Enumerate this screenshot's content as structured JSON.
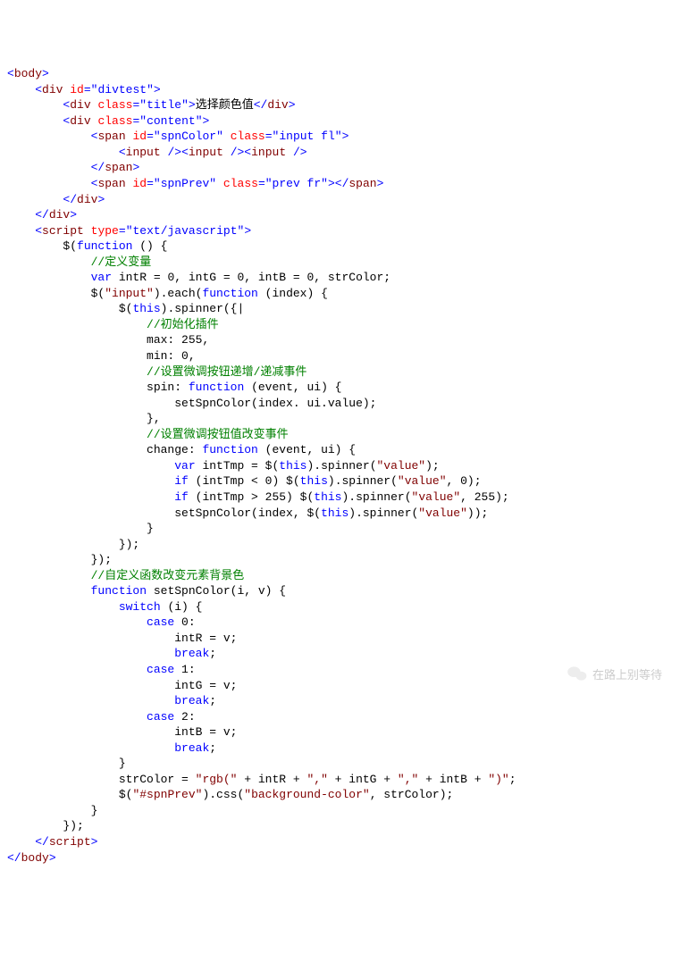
{
  "watermark": {
    "text": "在路上别等待"
  },
  "code": {
    "lines": [
      [
        [
          "tag",
          "<"
        ],
        [
          "name",
          "body"
        ],
        [
          "tag",
          ">"
        ]
      ],
      [
        [
          "plain",
          "    "
        ],
        [
          "tag",
          "<"
        ],
        [
          "name",
          "div"
        ],
        [
          "plain",
          " "
        ],
        [
          "attr",
          "id"
        ],
        [
          "tag",
          "="
        ],
        [
          "val",
          "\"divtest\""
        ],
        [
          "tag",
          ">"
        ]
      ],
      [
        [
          "plain",
          "        "
        ],
        [
          "tag",
          "<"
        ],
        [
          "name",
          "div"
        ],
        [
          "plain",
          " "
        ],
        [
          "attr",
          "class"
        ],
        [
          "tag",
          "="
        ],
        [
          "val",
          "\"title\""
        ],
        [
          "tag",
          ">"
        ],
        [
          "plain",
          "选择颜色值"
        ],
        [
          "tag",
          "</"
        ],
        [
          "name",
          "div"
        ],
        [
          "tag",
          ">"
        ]
      ],
      [
        [
          "plain",
          "        "
        ],
        [
          "tag",
          "<"
        ],
        [
          "name",
          "div"
        ],
        [
          "plain",
          " "
        ],
        [
          "attr",
          "class"
        ],
        [
          "tag",
          "="
        ],
        [
          "val",
          "\"content\""
        ],
        [
          "tag",
          ">"
        ]
      ],
      [
        [
          "plain",
          "            "
        ],
        [
          "tag",
          "<"
        ],
        [
          "name",
          "span"
        ],
        [
          "plain",
          " "
        ],
        [
          "attr",
          "id"
        ],
        [
          "tag",
          "="
        ],
        [
          "val",
          "\"spnColor\""
        ],
        [
          "plain",
          " "
        ],
        [
          "attr",
          "class"
        ],
        [
          "tag",
          "="
        ],
        [
          "val",
          "\"input fl\""
        ],
        [
          "tag",
          ">"
        ]
      ],
      [
        [
          "plain",
          "                "
        ],
        [
          "tag",
          "<"
        ],
        [
          "name",
          "input"
        ],
        [
          "plain",
          " "
        ],
        [
          "tag",
          "/><"
        ],
        [
          "name",
          "input"
        ],
        [
          "plain",
          " "
        ],
        [
          "tag",
          "/><"
        ],
        [
          "name",
          "input"
        ],
        [
          "plain",
          " "
        ],
        [
          "tag",
          "/>"
        ]
      ],
      [
        [
          "plain",
          "            "
        ],
        [
          "tag",
          "</"
        ],
        [
          "name",
          "span"
        ],
        [
          "tag",
          ">"
        ]
      ],
      [
        [
          "plain",
          "            "
        ],
        [
          "tag",
          "<"
        ],
        [
          "name",
          "span"
        ],
        [
          "plain",
          " "
        ],
        [
          "attr",
          "id"
        ],
        [
          "tag",
          "="
        ],
        [
          "val",
          "\"spnPrev\""
        ],
        [
          "plain",
          " "
        ],
        [
          "attr",
          "class"
        ],
        [
          "tag",
          "="
        ],
        [
          "val",
          "\"prev fr\""
        ],
        [
          "tag",
          "></"
        ],
        [
          "name",
          "span"
        ],
        [
          "tag",
          ">"
        ]
      ],
      [
        [
          "plain",
          "        "
        ],
        [
          "tag",
          "</"
        ],
        [
          "name",
          "div"
        ],
        [
          "tag",
          ">"
        ]
      ],
      [
        [
          "plain",
          "    "
        ],
        [
          "tag",
          "</"
        ],
        [
          "name",
          "div"
        ],
        [
          "tag",
          ">"
        ]
      ],
      [
        [
          "plain",
          "    "
        ],
        [
          "tag",
          "<"
        ],
        [
          "name",
          "script"
        ],
        [
          "plain",
          " "
        ],
        [
          "attr",
          "type"
        ],
        [
          "tag",
          "="
        ],
        [
          "val",
          "\"text/javascript\""
        ],
        [
          "tag",
          ">"
        ]
      ],
      [
        [
          "plain",
          "        $("
        ],
        [
          "kw",
          "function"
        ],
        [
          "plain",
          " () {"
        ]
      ],
      [
        [
          "plain",
          "            "
        ],
        [
          "cmt",
          "//定义变量"
        ]
      ],
      [
        [
          "plain",
          "            "
        ],
        [
          "kw",
          "var"
        ],
        [
          "plain",
          " intR = 0, intG = 0, intB = 0, strColor;"
        ]
      ],
      [
        [
          "plain",
          "            $("
        ],
        [
          "str",
          "\"input\""
        ],
        [
          "plain",
          ").each("
        ],
        [
          "kw",
          "function"
        ],
        [
          "plain",
          " (index) {"
        ]
      ],
      [
        [
          "plain",
          "                $("
        ],
        [
          "kw",
          "this"
        ],
        [
          "plain",
          ").spinner({|"
        ]
      ],
      [
        [
          "plain",
          "                    "
        ],
        [
          "cmt",
          "//初始化插件"
        ]
      ],
      [
        [
          "plain",
          "                    max: 255,"
        ]
      ],
      [
        [
          "plain",
          "                    min: 0,"
        ]
      ],
      [
        [
          "plain",
          "                    "
        ],
        [
          "cmt",
          "//设置微调按钮递增/递减事件"
        ]
      ],
      [
        [
          "plain",
          "                    spin: "
        ],
        [
          "kw",
          "function"
        ],
        [
          "plain",
          " (event, ui) {"
        ]
      ],
      [
        [
          "plain",
          "                        setSpnColor(index. ui.value);"
        ]
      ],
      [
        [
          "plain",
          "                    },"
        ]
      ],
      [
        [
          "plain",
          "                    "
        ],
        [
          "cmt",
          "//设置微调按钮值改变事件"
        ]
      ],
      [
        [
          "plain",
          "                    change: "
        ],
        [
          "kw",
          "function"
        ],
        [
          "plain",
          " (event, ui) {"
        ]
      ],
      [
        [
          "plain",
          "                        "
        ],
        [
          "kw",
          "var"
        ],
        [
          "plain",
          " intTmp = $("
        ],
        [
          "kw",
          "this"
        ],
        [
          "plain",
          ").spinner("
        ],
        [
          "str",
          "\"value\""
        ],
        [
          "plain",
          ");"
        ]
      ],
      [
        [
          "plain",
          "                        "
        ],
        [
          "kw",
          "if"
        ],
        [
          "plain",
          " (intTmp < 0) $("
        ],
        [
          "kw",
          "this"
        ],
        [
          "plain",
          ").spinner("
        ],
        [
          "str",
          "\"value\""
        ],
        [
          "plain",
          ", 0);"
        ]
      ],
      [
        [
          "plain",
          "                        "
        ],
        [
          "kw",
          "if"
        ],
        [
          "plain",
          " (intTmp > 255) $("
        ],
        [
          "kw",
          "this"
        ],
        [
          "plain",
          ").spinner("
        ],
        [
          "str",
          "\"value\""
        ],
        [
          "plain",
          ", 255);"
        ]
      ],
      [
        [
          "plain",
          "                        setSpnColor(index, $("
        ],
        [
          "kw",
          "this"
        ],
        [
          "plain",
          ").spinner("
        ],
        [
          "str",
          "\"value\""
        ],
        [
          "plain",
          "));"
        ]
      ],
      [
        [
          "plain",
          "                    }"
        ]
      ],
      [
        [
          "plain",
          "                });"
        ]
      ],
      [
        [
          "plain",
          "            });"
        ]
      ],
      [
        [
          "plain",
          "            "
        ],
        [
          "cmt",
          "//自定义函数改变元素背景色"
        ]
      ],
      [
        [
          "plain",
          "            "
        ],
        [
          "kw",
          "function"
        ],
        [
          "plain",
          " setSpnColor(i, v) {"
        ]
      ],
      [
        [
          "plain",
          "                "
        ],
        [
          "kw",
          "switch"
        ],
        [
          "plain",
          " (i) {"
        ]
      ],
      [
        [
          "plain",
          "                    "
        ],
        [
          "kw",
          "case"
        ],
        [
          "plain",
          " 0:"
        ]
      ],
      [
        [
          "plain",
          "                        intR = v;"
        ]
      ],
      [
        [
          "plain",
          "                        "
        ],
        [
          "kw",
          "break"
        ],
        [
          "plain",
          ";"
        ]
      ],
      [
        [
          "plain",
          "                    "
        ],
        [
          "kw",
          "case"
        ],
        [
          "plain",
          " 1:"
        ]
      ],
      [
        [
          "plain",
          "                        intG = v;"
        ]
      ],
      [
        [
          "plain",
          "                        "
        ],
        [
          "kw",
          "break"
        ],
        [
          "plain",
          ";"
        ]
      ],
      [
        [
          "plain",
          "                    "
        ],
        [
          "kw",
          "case"
        ],
        [
          "plain",
          " 2:"
        ]
      ],
      [
        [
          "plain",
          "                        intB = v;"
        ]
      ],
      [
        [
          "plain",
          "                        "
        ],
        [
          "kw",
          "break"
        ],
        [
          "plain",
          ";"
        ]
      ],
      [
        [
          "plain",
          "                }"
        ]
      ],
      [
        [
          "plain",
          "                strColor = "
        ],
        [
          "str",
          "\"rgb(\""
        ],
        [
          "plain",
          " + intR + "
        ],
        [
          "str",
          "\",\""
        ],
        [
          "plain",
          " + intG + "
        ],
        [
          "str",
          "\",\""
        ],
        [
          "plain",
          " + intB + "
        ],
        [
          "str",
          "\")\""
        ],
        [
          "plain",
          ";"
        ]
      ],
      [
        [
          "plain",
          "                $("
        ],
        [
          "str",
          "\"#spnPrev\""
        ],
        [
          "plain",
          ").css("
        ],
        [
          "str",
          "\"background-color\""
        ],
        [
          "plain",
          ", strColor);"
        ]
      ],
      [
        [
          "plain",
          "            }"
        ]
      ],
      [
        [
          "plain",
          "        });"
        ]
      ],
      [
        [
          "plain",
          "    "
        ],
        [
          "tag",
          "</"
        ],
        [
          "name",
          "script"
        ],
        [
          "tag",
          ">"
        ]
      ],
      [
        [
          "tag",
          "</"
        ],
        [
          "name",
          "body"
        ],
        [
          "tag",
          ">"
        ]
      ]
    ]
  }
}
